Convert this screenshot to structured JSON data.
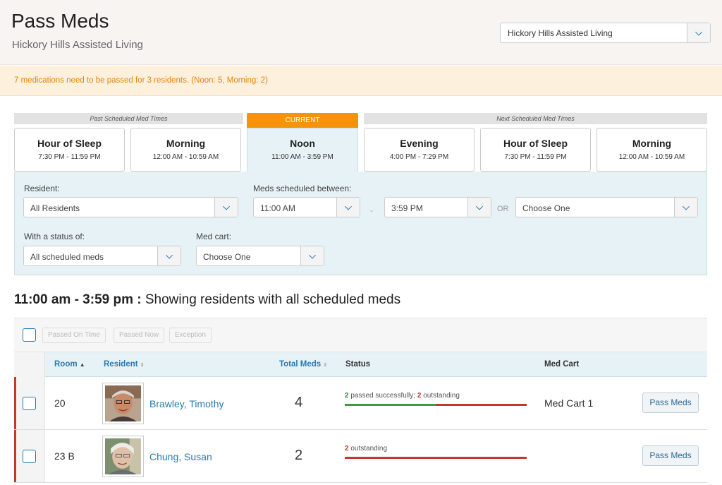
{
  "header": {
    "title": "Pass Meds",
    "subtitle": "Hickory Hills Assisted Living",
    "facility_select": "Hickory Hills Assisted Living"
  },
  "alert": {
    "text": "7 medications need to be passed for 3 residents. (Noon: 5, Morning: 2)"
  },
  "med_times": {
    "past_label": "Past Scheduled Med Times",
    "current_label": "CURRENT",
    "next_label": "Next Scheduled Med Times",
    "slots": [
      {
        "name": "Hour of Sleep",
        "range": "7:30 PM - 11:59 PM"
      },
      {
        "name": "Morning",
        "range": "12:00 AM - 10:59 AM"
      },
      {
        "name": "Noon",
        "range": "11:00 AM - 3:59 PM"
      },
      {
        "name": "Evening",
        "range": "4:00 PM - 7:29 PM"
      },
      {
        "name": "Hour of Sleep",
        "range": "7:30 PM - 11:59 PM"
      },
      {
        "name": "Morning",
        "range": "12:00 AM - 10:59 AM"
      }
    ]
  },
  "filters": {
    "resident_label": "Resident:",
    "resident_value": "All Residents",
    "between_label": "Meds scheduled between:",
    "from_value": "11:00 AM",
    "to_value": "3:59 PM",
    "dash": "-",
    "or_text": "OR",
    "choose_value": "Choose One",
    "status_label": "With a status of:",
    "status_value": "All scheduled meds",
    "cart_label": "Med cart:",
    "cart_value": "Choose One"
  },
  "showing": {
    "range": "11:00 am - 3:59 pm :",
    "text": "Showing residents with all scheduled meds"
  },
  "toolbar": {
    "passed_on_time": "Passed On Time",
    "passed_now": "Passed Now",
    "exception": "Exception"
  },
  "table": {
    "columns": {
      "room": "Room",
      "resident": "Resident",
      "total": "Total Meds",
      "status": "Status",
      "cart": "Med Cart"
    },
    "rows": [
      {
        "room": "20",
        "resident": "Brawley, Timothy",
        "total": "4",
        "passed": "2",
        "passed_text": "passed successfully;",
        "outstanding": "2",
        "outstanding_text": "outstanding",
        "passed_fraction": 0.5,
        "cart": "Med Cart 1",
        "action": "Pass Meds"
      },
      {
        "room": "23 B",
        "resident": "Chung, Susan",
        "total": "2",
        "passed": "",
        "passed_text": "",
        "outstanding": "2",
        "outstanding_text": "outstanding",
        "passed_fraction": 0,
        "cart": "",
        "action": "Pass Meds"
      }
    ]
  },
  "colors": {
    "accent": "#2a7ab0",
    "current": "#f5940a",
    "alert_text": "#e8850c",
    "success": "#3d9a47",
    "danger": "#c0392b"
  },
  "icons": {
    "dropdown": "chevron-down-icon",
    "sort": "sort-icon"
  }
}
